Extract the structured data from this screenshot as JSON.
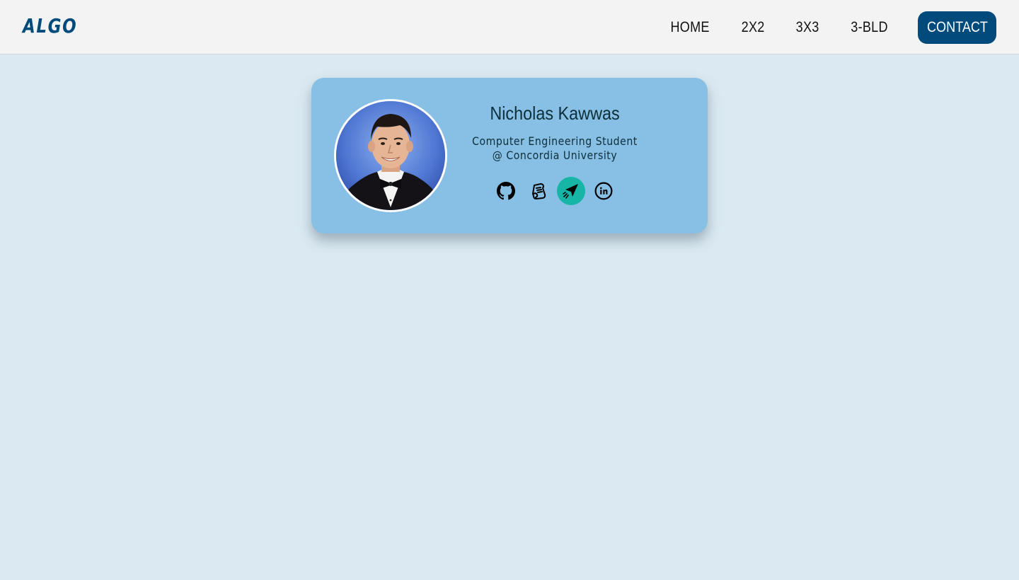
{
  "brand": {
    "logo_text": "ALGO",
    "color": "#004a7c"
  },
  "nav": {
    "links": [
      {
        "label": "HOME"
      },
      {
        "label": "2X2"
      },
      {
        "label": "3X3"
      },
      {
        "label": "3-BLD"
      }
    ],
    "contact_label": "CONTACT",
    "contact_color": "#014a7c"
  },
  "profile": {
    "name": "Nicholas Kawwas",
    "title_line1": "Computer Engineering Student",
    "title_line2": "@ Concordia University",
    "avatar_alt": "Nicholas Kawwas",
    "card_color": "#88bfe5",
    "socials": [
      {
        "icon": "github-icon"
      },
      {
        "icon": "scroll-icon"
      },
      {
        "icon": "paper-plane-icon",
        "active": true,
        "active_color": "#17b5a6"
      },
      {
        "icon": "linkedin-icon"
      }
    ]
  },
  "page": {
    "background": "#dbeaf2"
  }
}
